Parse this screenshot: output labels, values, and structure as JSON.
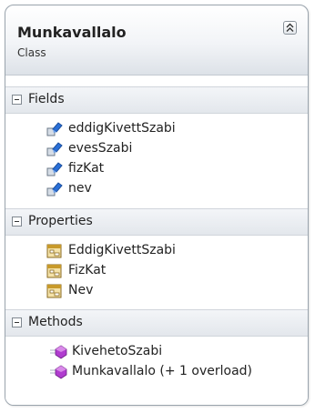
{
  "class": {
    "name": "Munkavallalo",
    "kind": "Class"
  },
  "sections": {
    "fields": {
      "label": "Fields",
      "items": [
        "eddigKivettSzabi",
        "evesSzabi",
        "fizKat",
        "nev"
      ]
    },
    "properties": {
      "label": "Properties",
      "items": [
        "EddigKivettSzabi",
        "FizKat",
        "Nev"
      ]
    },
    "methods": {
      "label": "Methods",
      "items": [
        "KivehetoSzabi",
        "Munkavallalo (+ 1 overload)"
      ]
    }
  },
  "icons": {
    "collapse": "double-chevron-up-icon",
    "section_toggle": "minus-box-icon",
    "field": "field-icon",
    "property": "property-icon",
    "method": "method-icon"
  },
  "colors": {
    "border": "#9aa4ad",
    "field_icon": "#2a6fd6",
    "method_icon": "#b03ccf",
    "property_icon": "#c89a2a"
  }
}
